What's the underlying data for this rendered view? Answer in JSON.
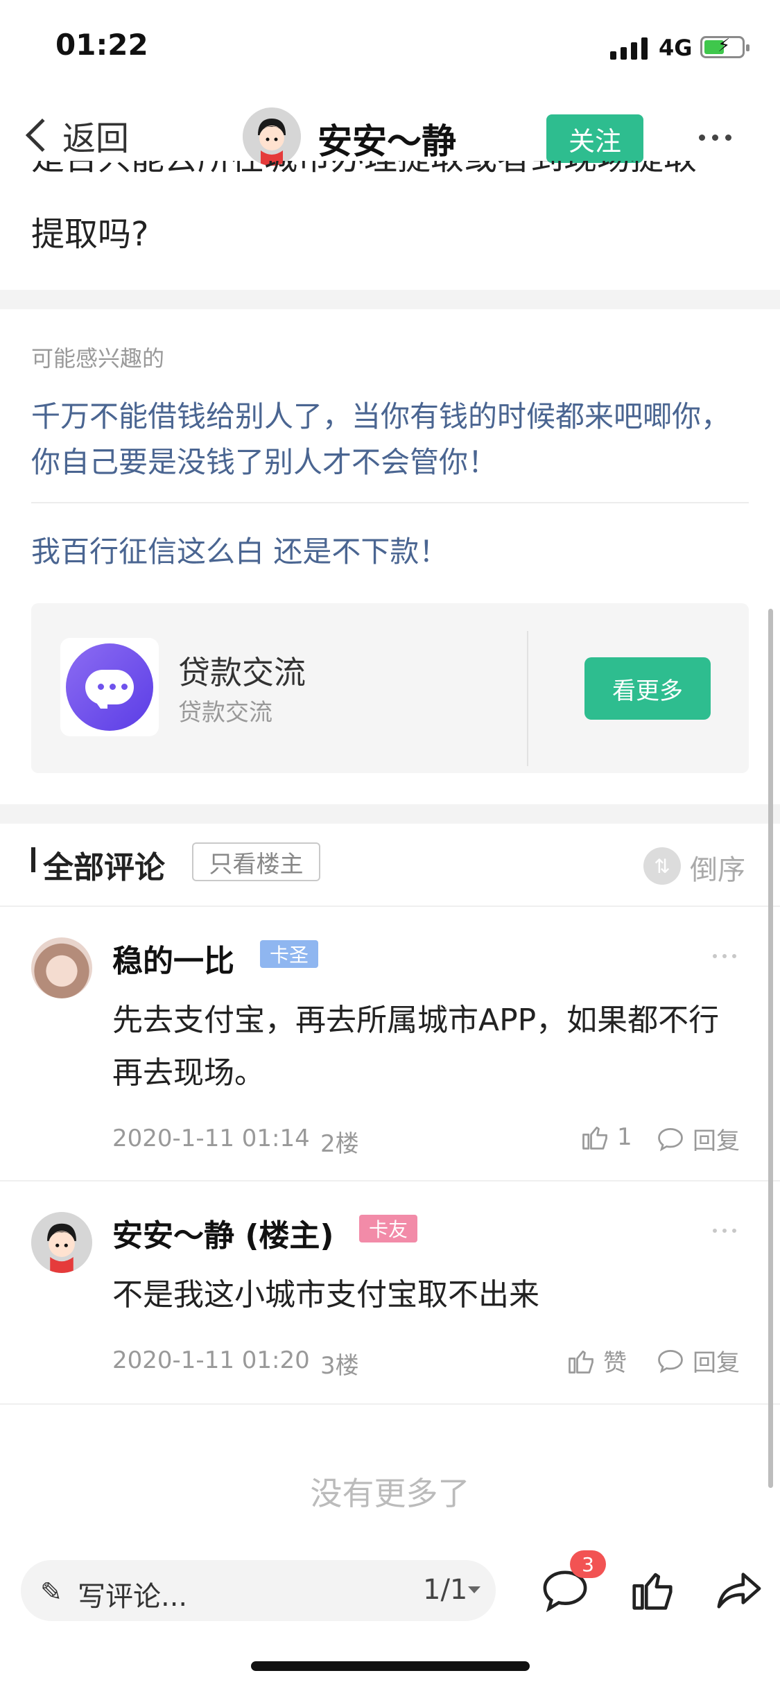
{
  "status_bar": {
    "time": "01:22",
    "network": "4G"
  },
  "nav": {
    "back_label": "返回",
    "author_name": "安安～静",
    "follow_label": "关注"
  },
  "post": {
    "text_tail": "提取吗?",
    "text_cut": "是否只能去所在城市办理提取或者到现场提取"
  },
  "interest": {
    "label": "可能感兴趣的",
    "items": [
      "千万不能借钱给别人了，当你有钱的时候都来吧唧你，你自己要是没钱了别人才不会管你！",
      "我百行征信这么白 还是不下款！"
    ]
  },
  "group_card": {
    "title": "贷款交流",
    "subtitle": "贷款交流",
    "button_label": "看更多",
    "accent": "#2ebd8f"
  },
  "comments_header": {
    "title": "全部评论",
    "owner_only_label": "只看楼主",
    "order_label": "倒序"
  },
  "comments": [
    {
      "username": "稳的一比",
      "badge": "卡圣",
      "badge_color": "#8fb6f0",
      "text": "先去支付宝，再去所属城市APP，如果都不行再去现场。",
      "timestamp": "2020-1-11 01:14",
      "floor": "2楼",
      "like_label": "1",
      "reply_label": "回复"
    },
    {
      "username": "安安～静 (楼主)",
      "badge": "卡友",
      "badge_color": "#f28ba8",
      "text": "不是我这小城市支付宝取不出来",
      "timestamp": "2020-1-11 01:20",
      "floor": "3楼",
      "like_label": "赞",
      "reply_label": "回复"
    }
  ],
  "no_more_label": "没有更多了",
  "bottom_bar": {
    "input_placeholder": "写评论...",
    "page_indicator": "1/1",
    "comment_count": "3",
    "icons": [
      "comment-icon",
      "thumbs-up-icon",
      "share-icon"
    ]
  }
}
